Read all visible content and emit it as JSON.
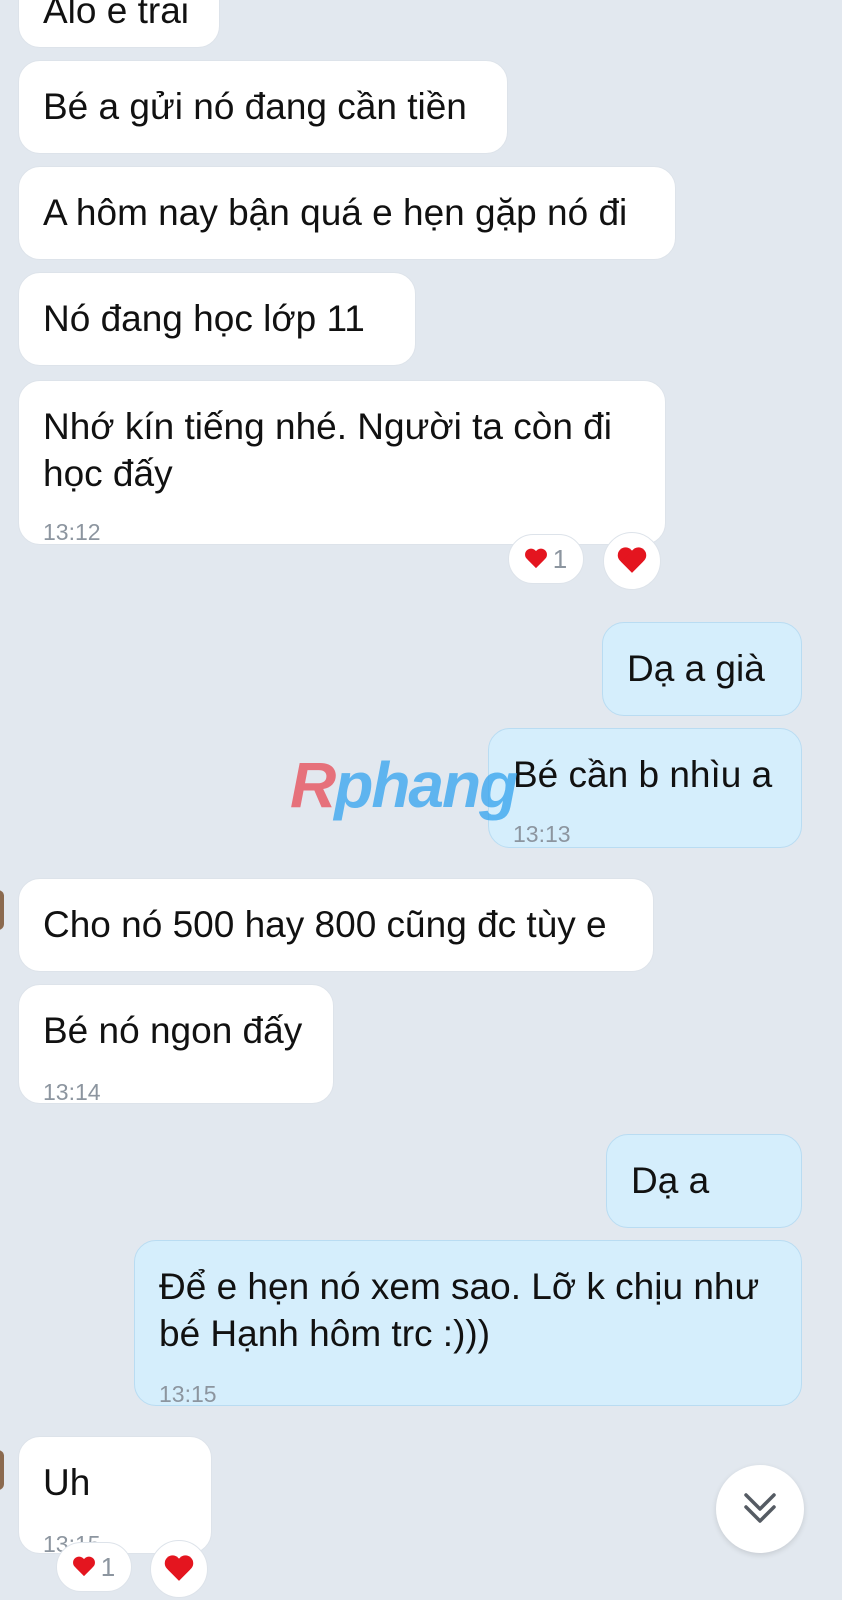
{
  "messages": [
    {
      "text": "Alo e trai",
      "time": ""
    },
    {
      "text": "Bé a gửi nó đang cần tiền",
      "time": ""
    },
    {
      "text": "A hôm nay bận quá e hẹn gặp nó đi",
      "time": ""
    },
    {
      "text": "Nó đang học lớp 11",
      "time": ""
    },
    {
      "text": "Nhớ kín tiếng nhé. Người ta còn đi học đấy",
      "time": "13:12",
      "reaction_count": "1"
    },
    {
      "text": "Dạ a già",
      "time": ""
    },
    {
      "text": "Bé cần b nhìu a",
      "time": "13:13"
    },
    {
      "text": "Cho nó 500 hay 800 cũng đc tùy e",
      "time": ""
    },
    {
      "text": "Bé nó ngon đấy",
      "time": "13:14"
    },
    {
      "text": "Dạ a",
      "time": ""
    },
    {
      "text": "Để e hẹn nó xem sao. Lỡ k chịu như bé Hạnh hôm trc :)))",
      "time": "13:15"
    },
    {
      "text": "Uh",
      "time": "13:15",
      "reaction_count": "1"
    }
  ],
  "watermark": {
    "first": "R",
    "rest": "phang"
  },
  "colors": {
    "background": "#e2e8ef",
    "incoming_bubble": "#ffffff",
    "outgoing_bubble": "#d5eefc",
    "heart": "#e4151f",
    "timestamp": "#8c959f"
  },
  "icons": [
    "heart-icon",
    "chevron-double-down-icon"
  ]
}
